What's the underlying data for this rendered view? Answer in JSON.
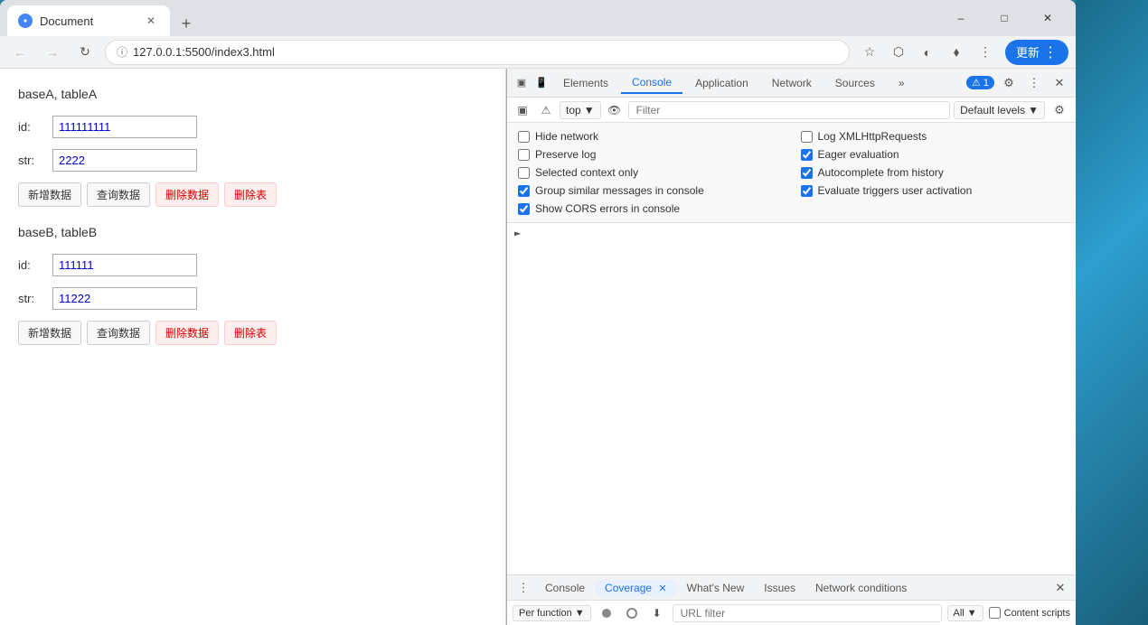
{
  "browser": {
    "tab_title": "Document",
    "url": "127.0.0.1:5500/index3.html",
    "url_full": "http://127.0.0.1:5500/index3.html",
    "update_btn": "更新",
    "new_tab_icon": "+"
  },
  "page": {
    "section_a_title": "baseA, tableA",
    "section_b_title": "baseB, tableB",
    "id_label": "id:",
    "str_label": "str:",
    "id_a_value": "111111111",
    "str_a_value": "2222",
    "id_b_value": "111111",
    "str_b_value": "11222",
    "btn_add": "新增数据",
    "btn_query": "查询数据",
    "btn_delete": "删除数据",
    "btn_drop": "删除表"
  },
  "devtools": {
    "tabs": [
      "Elements",
      "Console",
      "Application",
      "Network",
      "Sources",
      "»"
    ],
    "active_tab": "Console",
    "issue_count": "1",
    "issue_label": "1 Issue:",
    "issue_badge": "1",
    "console_top": "top",
    "filter_placeholder": "Filter",
    "levels_label": "Default levels",
    "settings": [
      {
        "id": "hide-network",
        "label": "Hide network",
        "checked": false,
        "blue": false
      },
      {
        "id": "log-xml",
        "label": "Log XMLHttpRequests",
        "checked": false,
        "blue": false
      },
      {
        "id": "preserve-log",
        "label": "Preserve log",
        "checked": false,
        "blue": false
      },
      {
        "id": "eager-eval",
        "label": "Eager evaluation",
        "checked": true,
        "blue": true
      },
      {
        "id": "selected-ctx",
        "label": "Selected context only",
        "checked": false,
        "blue": false
      },
      {
        "id": "autocomplete",
        "label": "Autocomplete from history",
        "checked": true,
        "blue": true
      },
      {
        "id": "group-similar",
        "label": "Group similar messages in console",
        "checked": true,
        "blue": true
      },
      {
        "id": "eval-triggers",
        "label": "Evaluate triggers user activation",
        "checked": true,
        "blue": true
      },
      {
        "id": "show-cors",
        "label": "Show CORS errors in console",
        "checked": true,
        "blue": true
      }
    ],
    "bottom_tabs": [
      "Console",
      "Coverage",
      "What's New",
      "Issues",
      "Network conditions"
    ],
    "active_bottom_tab": "Coverage",
    "per_function_label": "Per function",
    "url_filter_placeholder": "URL filter",
    "all_label": "All",
    "content_scripts_label": "Content scripts"
  }
}
